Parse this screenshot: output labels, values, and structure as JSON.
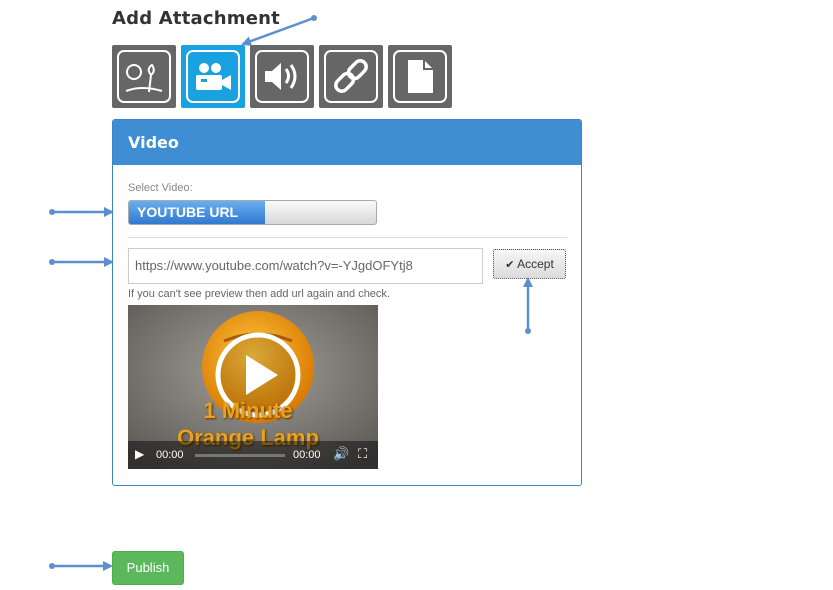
{
  "header": {
    "title": "Add Attachment"
  },
  "attachment_types": [
    {
      "icon": "image-icon",
      "active": false
    },
    {
      "icon": "video-camera-icon",
      "active": true
    },
    {
      "icon": "speaker-icon",
      "active": false
    },
    {
      "icon": "link-icon",
      "active": false
    },
    {
      "icon": "document-icon",
      "active": false
    }
  ],
  "panel": {
    "title": "Video",
    "select_label": "Select Video:",
    "toggle_label": "YOUTUBE URL",
    "url_value": "https://www.youtube.com/watch?v=-YJgdOFYtj8",
    "accept_label": "Accept",
    "hint": "If you can't see preview then add url again and check.",
    "video": {
      "overlay_line1": "1 Minute",
      "overlay_line2": "Orange Lamp",
      "current_time": "00:00",
      "duration": "00:00"
    }
  },
  "publish_label": "Publish",
  "colors": {
    "accent": "#3f8ed3",
    "active_tab": "#1aa2e0",
    "inactive_tab": "#666666",
    "publish": "#5cb85c",
    "annotation_arrow": "#5b8fd0"
  }
}
